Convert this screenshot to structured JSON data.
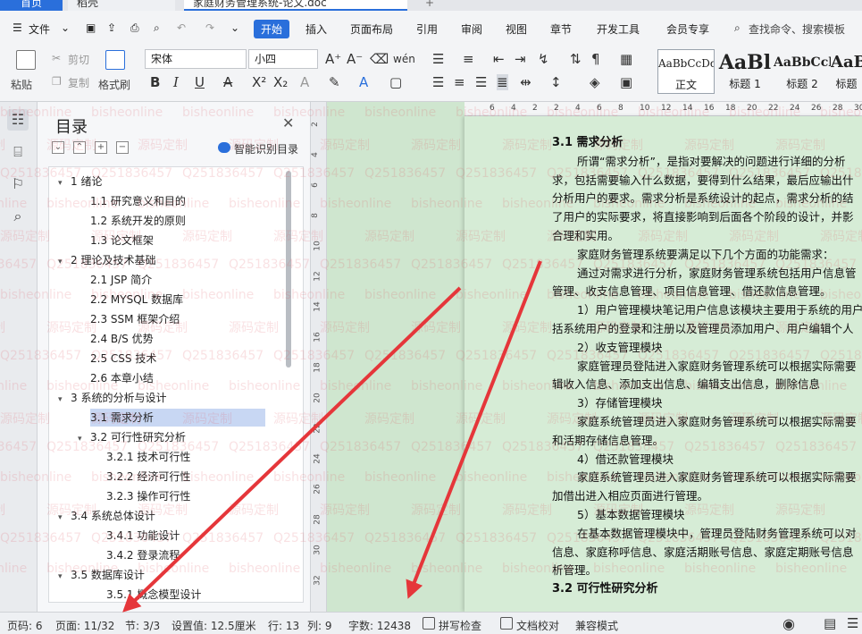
{
  "titlebar": {
    "tabs": [
      {
        "label": "首页"
      },
      {
        "label": "稻壳"
      },
      {
        "label": "家庭财务管理系统-论文.doc"
      }
    ]
  },
  "menu": {
    "file": "文件",
    "items": [
      "开始",
      "插入",
      "页面布局",
      "引用",
      "审阅",
      "视图",
      "章节",
      "开发工具",
      "会员专享"
    ],
    "active": "开始",
    "search": "查找命令、搜索模板"
  },
  "ribbon": {
    "paste": "粘贴",
    "cut": "剪切",
    "copy": "复制",
    "format_painter": "格式刷",
    "font_name": "宋体",
    "font_size": "小四",
    "styles": [
      {
        "preview": "AaBbCcDd",
        "name": "正文"
      },
      {
        "preview": "AaBl",
        "name": "标题 1"
      },
      {
        "preview": "AaBbCcl",
        "name": "标题 2"
      },
      {
        "preview": "AaBl",
        "name": "标题"
      }
    ]
  },
  "toc": {
    "title": "目录",
    "smart": "智能识别目录",
    "items": [
      {
        "label": "1  绪论",
        "level": 1,
        "arrow": "down"
      },
      {
        "label": "1.1  研究意义和目的",
        "level": 2
      },
      {
        "label": "1.2  系统开发的原则",
        "level": 2
      },
      {
        "label": "1.3  论文框架",
        "level": 2
      },
      {
        "label": "2  理论及技术基础",
        "level": 1,
        "arrow": "down"
      },
      {
        "label": "2.1 JSP 简介",
        "level": 2
      },
      {
        "label": "2.2 MYSQL 数据库",
        "level": 2
      },
      {
        "label": "2.3 SSM 框架介绍",
        "level": 2
      },
      {
        "label": "2.4 B/S 优势",
        "level": 2
      },
      {
        "label": "2.5 CSS 技术",
        "level": 2
      },
      {
        "label": "2.6  本章小结",
        "level": 2
      },
      {
        "label": "3  系统的分析与设计",
        "level": 1,
        "arrow": "down"
      },
      {
        "label": "3.1  需求分析",
        "level": 2,
        "selected": true
      },
      {
        "label": "3.2  可行性研究分析",
        "level": 2,
        "arrow": "down"
      },
      {
        "label": "3.2.1  技术可行性",
        "level": 3
      },
      {
        "label": "3.2.2  经济可行性",
        "level": 3
      },
      {
        "label": "3.2.3  操作可行性",
        "level": 3
      },
      {
        "label": "3.4  系统总体设计",
        "level": 1,
        "arrow": "down"
      },
      {
        "label": "3.4.1  功能设计",
        "level": 3
      },
      {
        "label": "3.4.2  登录流程",
        "level": 3
      },
      {
        "label": "3.5  数据库设计",
        "level": 1,
        "arrow": "down"
      },
      {
        "label": "3.5.1  概念模型设计",
        "level": 3
      }
    ]
  },
  "ruler": {
    "h": [
      "6",
      "4",
      "2",
      "2",
      "4",
      "6",
      "8",
      "10",
      "12",
      "14",
      "16",
      "18",
      "20",
      "22",
      "24",
      "26",
      "28",
      "30"
    ],
    "v": [
      "2",
      "4",
      "6",
      "8",
      "10",
      "12",
      "14",
      "16",
      "18",
      "20",
      "22",
      "24",
      "26",
      "28",
      "30",
      "32"
    ]
  },
  "document": {
    "lines": [
      {
        "t": "3.1 需求分析",
        "k": "h"
      },
      {
        "t": "所谓“需求分析”，是指对要解决的问题进行详细的分析",
        "k": "ind"
      },
      {
        "t": "求，包括需要输入什么数据，要得到什么结果，最后应输出什",
        "k": ""
      },
      {
        "t": "分析用户的要求。需求分析是系统设计的起点，需求分析的结",
        "k": ""
      },
      {
        "t": "了用户的实际要求，将直接影响到后面各个阶段的设计，并影",
        "k": ""
      },
      {
        "t": "合理和实用。",
        "k": ""
      },
      {
        "t": "家庭财务管理系统要满足以下几个方面的功能需求：",
        "k": "ind"
      },
      {
        "t": "通过对需求进行分析，家庭财务管理系统包括用户信息管",
        "k": "ind"
      },
      {
        "t": "管理、收支信息管理、项目信息管理、借还款信息管理。",
        "k": ""
      },
      {
        "t": "1）用户管理模块笔记用户信息该模块主要用于系统的用户",
        "k": "ind"
      },
      {
        "t": "括系统用户的登录和注册以及管理员添加用户、用户编辑个人",
        "k": ""
      },
      {
        "t": "2）收支管理模块",
        "k": "ind"
      },
      {
        "t": "家庭管理员登陆进入家庭财务管理系统可以根据实际需要",
        "k": "ind"
      },
      {
        "t": "辑收入信息、添加支出信息、编辑支出信息，删除信息",
        "k": ""
      },
      {
        "t": "3）存储管理模块",
        "k": "ind"
      },
      {
        "t": "家庭系统管理员进入家庭财务管理系统可以根据实际需要",
        "k": "ind"
      },
      {
        "t": "和活期存储信息管理。",
        "k": ""
      },
      {
        "t": "4）借还款管理模块",
        "k": "ind"
      },
      {
        "t": "家庭系统管理员进入家庭财务管理系统可以根据实际需要",
        "k": "ind"
      },
      {
        "t": "加借出进入相应页面进行管理。",
        "k": ""
      },
      {
        "t": "5）基本数据管理模块",
        "k": "ind"
      },
      {
        "t": "在基本数据管理模块中，管理员登陆财务管理系统可以对",
        "k": "ind"
      },
      {
        "t": "信息、家庭称呼信息、家庭活期账号信息、家庭定期账号信息",
        "k": ""
      },
      {
        "t": "析管理。",
        "k": ""
      },
      {
        "t": "3.2 可行性研究分析",
        "k": "h"
      }
    ]
  },
  "watermark": {
    "lines": [
      "bisheonline",
      "源码定制",
      "Q251836457"
    ]
  },
  "status": {
    "page_code": "页码: 6",
    "page": "页面: 11/32",
    "section": "节: 3/3",
    "setting": "设置值: 12.5厘米",
    "row": "行: 13",
    "col": "列: 9",
    "words": "字数: 12438",
    "spell": "拼写检查",
    "proof": "文档校对",
    "compat": "兼容模式"
  },
  "colors": {
    "accent": "#2a6fdb",
    "doc_bg": "#d6ecd6",
    "arrow": "#e5363a"
  }
}
